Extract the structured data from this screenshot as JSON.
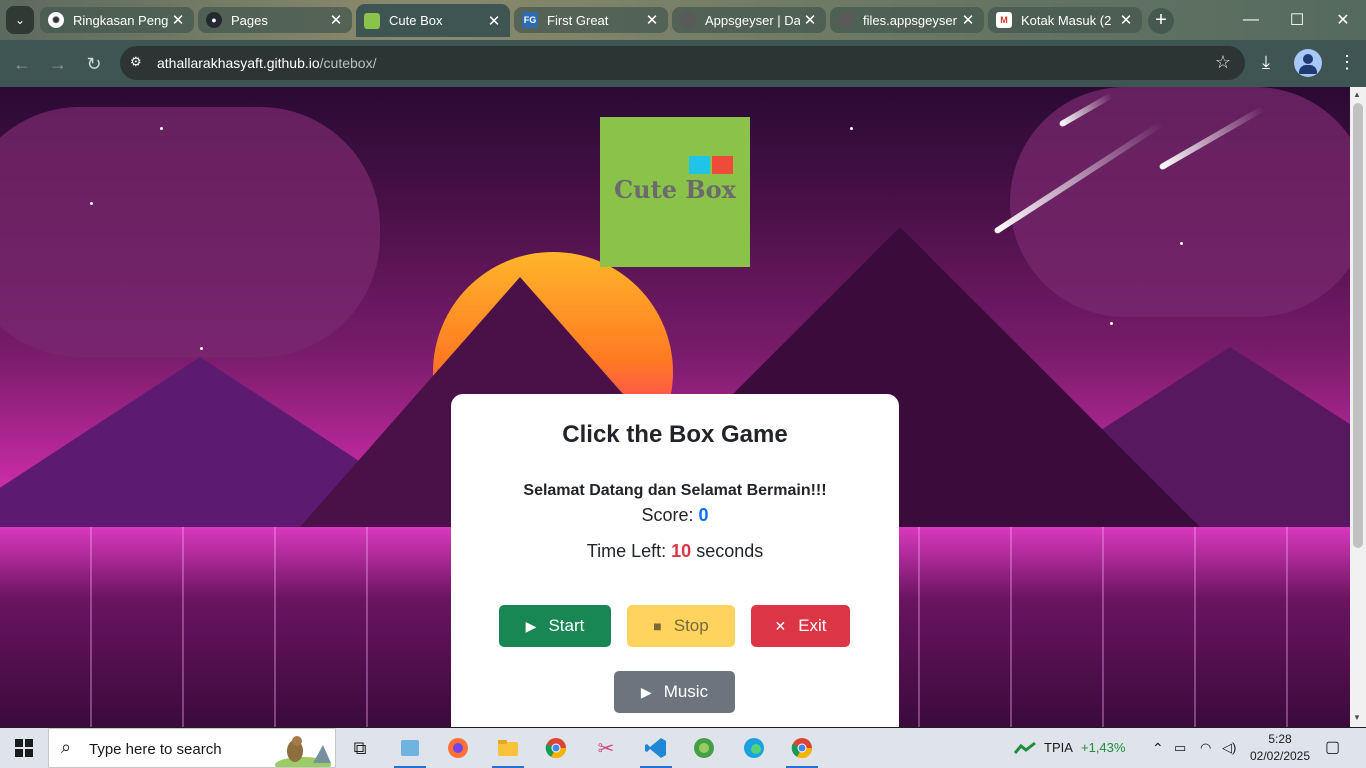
{
  "browser": {
    "tabs": [
      {
        "title": "Ringkasan Penga",
        "favicon": "openai-icon",
        "active": false
      },
      {
        "title": "Pages",
        "favicon": "github-icon",
        "active": false
      },
      {
        "title": "Cute Box",
        "favicon": "cutebox-icon",
        "active": true
      },
      {
        "title": "First Great",
        "favicon": "fg-icon",
        "favicon_text": "FG",
        "active": false
      },
      {
        "title": "Appsgeyser | Da",
        "favicon": "appsgeyser-icon",
        "active": false
      },
      {
        "title": "files.appsgeyser",
        "favicon": "appsgeyser-icon",
        "active": false
      },
      {
        "title": "Kotak Masuk (2",
        "favicon": "gmail-icon",
        "active": false
      }
    ],
    "url_host": "athallarakhasyaft.github.io",
    "url_path": "/cutebox/"
  },
  "page": {
    "logo_text": "Cute Box",
    "title": "Click the Box Game",
    "welcome": "Selamat Datang dan Selamat Bermain!!!",
    "score_label": "Score:",
    "score_value": "0",
    "time_label": "Time Left:",
    "time_value": "10",
    "time_unit": "seconds",
    "buttons": {
      "start": "Start",
      "stop": "Stop",
      "exit": "Exit",
      "music": "Music"
    }
  },
  "taskbar": {
    "search_placeholder": "Type here to search",
    "stock_name": "TPIA",
    "stock_change": "+1,43%",
    "time": "5:28",
    "date": "02/02/2025"
  },
  "colors": {
    "start": "#198754",
    "stop": "#ffd45e",
    "exit": "#dc3545",
    "music": "#6c757d",
    "score": "#0d6efd",
    "time": "#dc3545",
    "stock_up": "#1e8e3e"
  }
}
